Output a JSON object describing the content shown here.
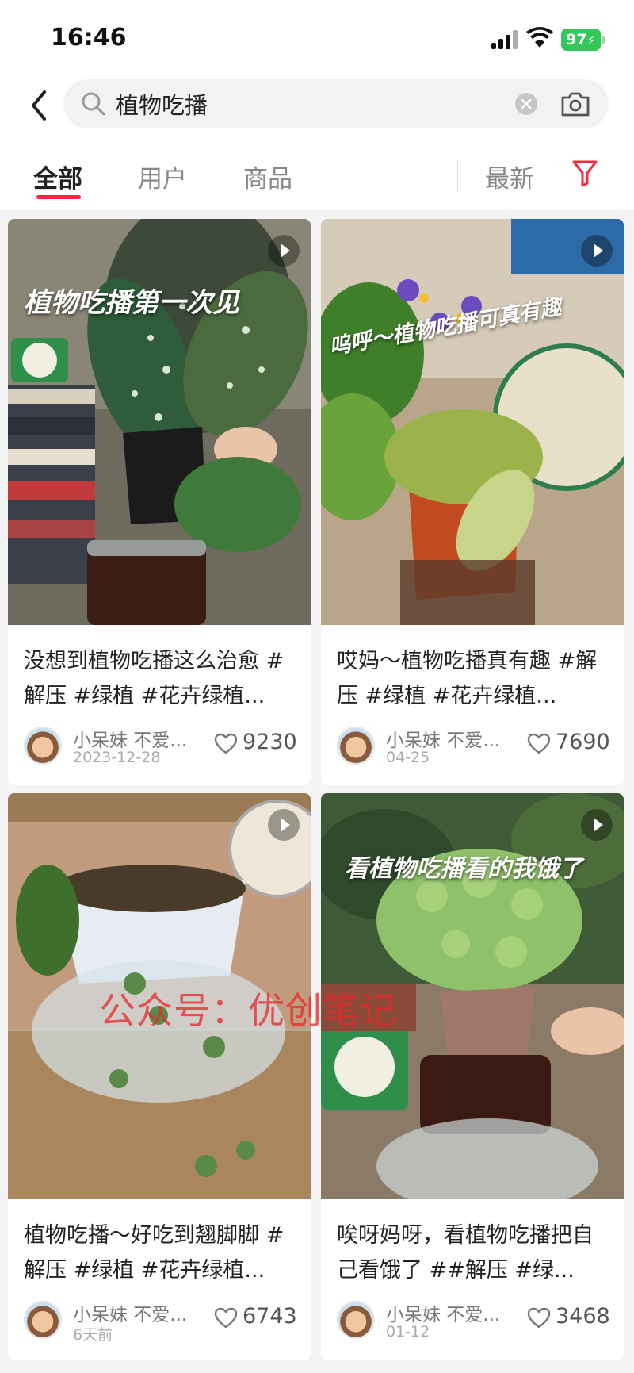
{
  "status": {
    "time": "16:46",
    "battery": "97"
  },
  "search": {
    "query": "植物吃播"
  },
  "tabs": [
    {
      "label": "全部",
      "active": true
    },
    {
      "label": "用户",
      "active": false
    },
    {
      "label": "商品",
      "active": false
    }
  ],
  "sort": {
    "label": "最新"
  },
  "cards": [
    {
      "overlay": "植物吃播第一次见",
      "title": "没想到植物吃播这么治愈 #解压 #绿植 #花卉绿植...",
      "author": "小呆妹 不爱...",
      "date": "2023-12-28",
      "likes": "9230"
    },
    {
      "overlay": "呜呼～植物吃播可真有趣",
      "title": "哎妈～植物吃播真有趣 #解压 #绿植 #花卉绿植...",
      "author": "小呆妹 不爱...",
      "date": "04-25",
      "likes": "7690"
    },
    {
      "overlay": "",
      "title": "植物吃播～好吃到翘脚脚 #解压 #绿植 #花卉绿植...",
      "author": "小呆妹 不爱...",
      "date": "6天前",
      "likes": "6743"
    },
    {
      "overlay": "看植物吃播看的我饿了",
      "title": "唉呀妈呀，看植物吃播把自己看饿了 ##解压 #绿...",
      "author": "小呆妹 不爱...",
      "date": "01-12",
      "likes": "3468"
    }
  ],
  "watermark": "公众号：优创笔记",
  "colors": {
    "accent": "#ff2442",
    "battery": "#34c759"
  }
}
